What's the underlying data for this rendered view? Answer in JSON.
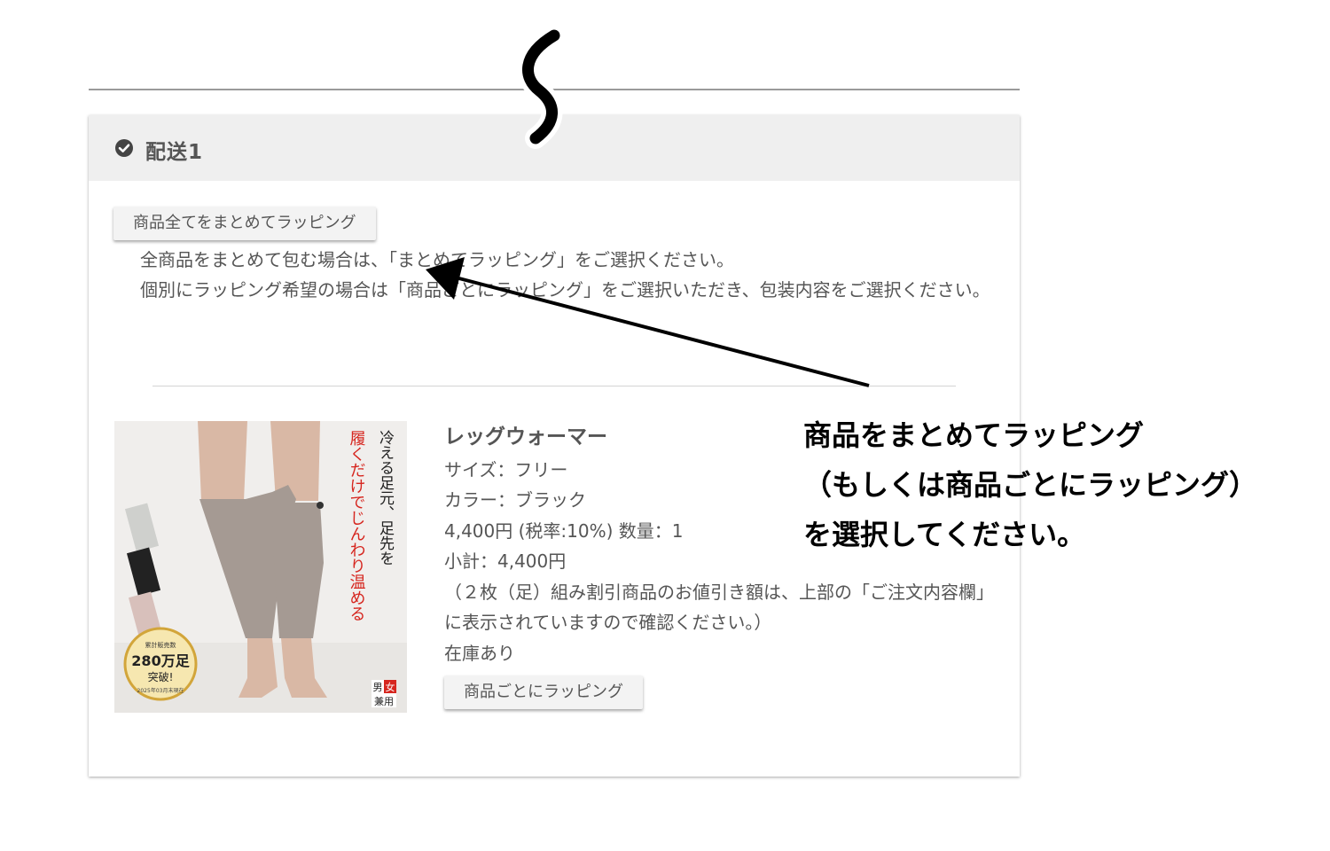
{
  "delivery": {
    "title": "配送1",
    "wrap_all_button": "商品全てをまとめてラッピング",
    "instructions": [
      "全商品をまとめて包む場合は、「まとめてラッピング」をご選択ください。",
      "個別にラッピング希望の場合は「商品ごとにラッピング」をご選択いただき、包装内容をご選択ください。"
    ]
  },
  "product": {
    "name": "レッグウォーマー",
    "size": "サイズ：フリー",
    "color": "カラー：ブラック",
    "price_qty": "4,400円 (税率:10%) 数量：1",
    "subtotal": "小計：4,400円",
    "discount_note": "（２枚（足）組み割引商品のお値引き額は、上部の「ご注文内容欄」に表示されていますので確認ください。）",
    "stock": "在庫あり",
    "wrap_each_button": "商品ごとにラッピング",
    "image": {
      "headline_1": "冷える足元、足先を",
      "headline_2": "履くだけでじんわり温める",
      "badge_top": "累計販売数",
      "badge_main": "280万足",
      "badge_sub": "突破!",
      "badge_date": "2025年03月末現在",
      "gender_1": "男",
      "gender_2": "女",
      "gender_3": "兼用"
    }
  },
  "annotation": {
    "lines": [
      "商品をまとめてラッピング",
      "（もしくは商品ごとにラッピング）",
      "を選択してください。"
    ]
  },
  "colors": {
    "header_bg": "#efefef",
    "arrow": "#000000",
    "image_red_text": "#d6261f"
  }
}
